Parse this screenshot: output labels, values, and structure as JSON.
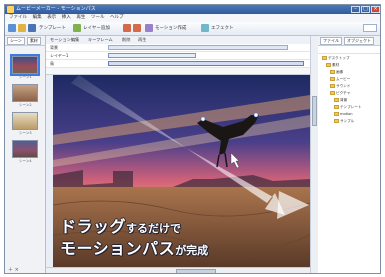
{
  "window": {
    "title": "ムービーメーカー - モーションパス"
  },
  "menu": [
    "ファイル",
    "編集",
    "表示",
    "挿入",
    "再生",
    "ツール",
    "ヘルプ"
  ],
  "toolbar": {
    "label1": "テンプレート",
    "label2": "レイヤー追加",
    "label3": "モーション作成",
    "label4": "エフェクト"
  },
  "editor_toolbar": {
    "label1": "モーション編集",
    "label2": "キーフレーム",
    "label3": "削除",
    "label4": "再生"
  },
  "timeline": {
    "rows": [
      {
        "name": "背景"
      },
      {
        "name": "レイヤー1"
      },
      {
        "name": "鳥"
      }
    ]
  },
  "thumbs": {
    "tabs": [
      "シーン",
      "素材"
    ],
    "labels": [
      "シーン1",
      "シーン2",
      "シーン3",
      "シーン4"
    ]
  },
  "panel": {
    "tabs": [
      "ファイル",
      "オブジェクト"
    ],
    "items": [
      "デスクトップ",
      "素材",
      "画像",
      "ムービー",
      "サウンド",
      "ピクチャ",
      "背景",
      "テンプレート",
      "motion",
      "サンプル"
    ]
  },
  "caption": {
    "line1_big": "ドラッグ",
    "line1_small": "するだけで",
    "line2_big": "モーションパス",
    "line2_small": "が完成"
  },
  "colors": {
    "accent": "#3d7be0",
    "titlebar": "#2f5a9c"
  }
}
